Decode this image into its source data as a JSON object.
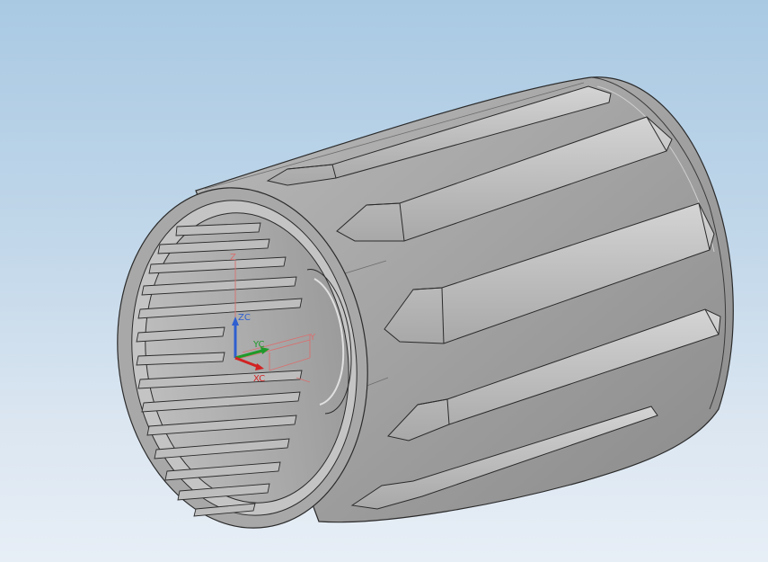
{
  "viewport": {
    "background_top": "#a9c9e3",
    "background_bottom": "#e7eef6"
  },
  "model": {
    "color": "#9c9c9c",
    "edge_color": "#2b2b2b"
  },
  "triad": {
    "zc_label": "ZC",
    "yc_label": "YC",
    "xc_label": "XC",
    "zc_color": "#2f5fd0",
    "yc_color": "#1f9a2a",
    "xc_color": "#d22222"
  },
  "datum_csys": {
    "z_label": "Z",
    "y_label": "Y",
    "color": "#d87070"
  }
}
